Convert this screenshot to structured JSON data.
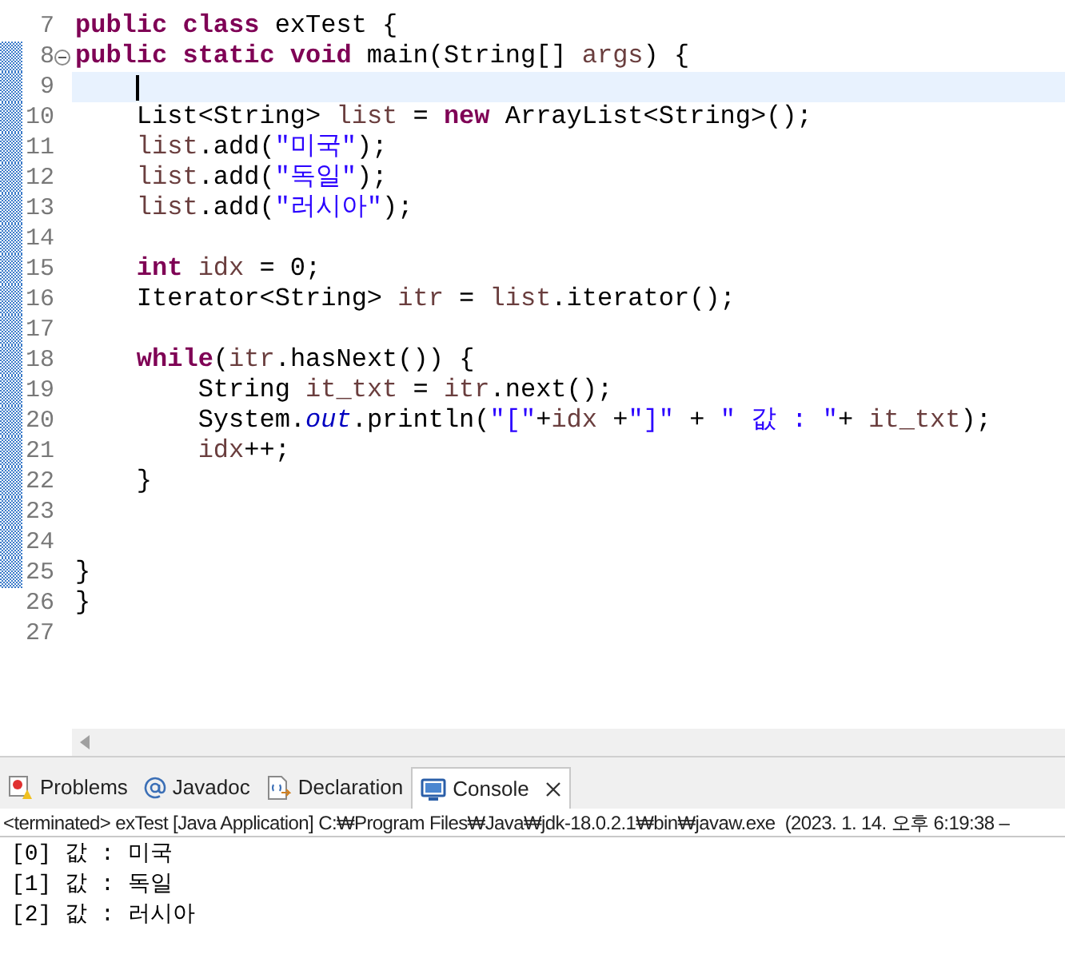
{
  "editor": {
    "lines": [
      {
        "number": "7",
        "foldable": false,
        "changed": false,
        "current": false,
        "tokens": [
          {
            "kind": "kw",
            "text": "public class"
          },
          {
            "kind": "plain",
            "text": " exTest {"
          }
        ]
      },
      {
        "number": "8",
        "foldable": true,
        "changed": true,
        "current": false,
        "tokens": [
          {
            "kind": "kw",
            "text": "public static void"
          },
          {
            "kind": "plain",
            "text": " main(String[] "
          },
          {
            "kind": "var",
            "text": "args"
          },
          {
            "kind": "plain",
            "text": ") {"
          }
        ],
        "children": [
          {
            "number": "9",
            "foldable": false,
            "changed": true,
            "current": true
          },
          {
            "number": "10",
            "foldable": false,
            "changed": true,
            "current": false,
            "tokens": [
              {
                "kind": "plain",
                "text": "List<String> "
              },
              {
                "kind": "var",
                "text": "list"
              },
              {
                "kind": "plain",
                "text": " = "
              },
              {
                "kind": "kw",
                "text": "new"
              },
              {
                "kind": "plain",
                "text": " ArrayList<String>();"
              }
            ]
          },
          {
            "number": "11",
            "foldable": false,
            "changed": true,
            "current": false,
            "tokens": [
              {
                "kind": "var",
                "text": "list"
              },
              {
                "kind": "plain",
                "text": ".add("
              },
              {
                "kind": "str",
                "text": "\"미국\""
              },
              {
                "kind": "plain",
                "text": ");"
              }
            ]
          },
          {
            "number": "12",
            "foldable": false,
            "changed": true,
            "current": false,
            "tokens": [
              {
                "kind": "var",
                "text": "list"
              },
              {
                "kind": "plain",
                "text": ".add("
              },
              {
                "kind": "str",
                "text": "\"독일\""
              },
              {
                "kind": "plain",
                "text": ");"
              }
            ]
          },
          {
            "number": "13",
            "foldable": false,
            "changed": true,
            "current": false,
            "tokens": [
              {
                "kind": "var",
                "text": "list"
              },
              {
                "kind": "plain",
                "text": ".add("
              },
              {
                "kind": "str",
                "text": "\"러시아\""
              },
              {
                "kind": "plain",
                "text": ");"
              }
            ]
          },
          {
            "number": "14",
            "foldable": false,
            "changed": true,
            "current": false
          },
          {
            "number": "15",
            "foldable": false,
            "changed": true,
            "current": false,
            "tokens": [
              {
                "kind": "kw",
                "text": "int "
              },
              {
                "kind": "var",
                "text": "idx"
              },
              {
                "kind": "plain",
                "text": " = 0;"
              }
            ]
          },
          {
            "number": "16",
            "foldable": false,
            "changed": true,
            "current": false,
            "tokens": [
              {
                "kind": "plain",
                "text": "Iterator<String> "
              },
              {
                "kind": "var",
                "text": "itr"
              },
              {
                "kind": "plain",
                "text": " = "
              },
              {
                "kind": "var",
                "text": "list"
              },
              {
                "kind": "plain",
                "text": ".iterator();"
              }
            ]
          },
          {
            "number": "17",
            "foldable": false,
            "changed": true,
            "current": false
          },
          {
            "number": "18",
            "foldable": false,
            "changed": true,
            "current": false,
            "tokens": [
              {
                "kind": "kw",
                "text": "while"
              },
              {
                "kind": "plain",
                "text": "("
              },
              {
                "kind": "var",
                "text": "itr"
              },
              {
                "kind": "plain",
                "text": ".hasNext()) {"
              }
            ],
            "children": [
              {
                "number": "19",
                "foldable": false,
                "changed": true,
                "current": false,
                "tokens": [
                  {
                    "kind": "plain",
                    "text": "String "
                  },
                  {
                    "kind": "var",
                    "text": "it_txt"
                  },
                  {
                    "kind": "plain",
                    "text": " = "
                  },
                  {
                    "kind": "var",
                    "text": "itr"
                  },
                  {
                    "kind": "plain",
                    "text": ".next();"
                  }
                ]
              },
              {
                "number": "20",
                "foldable": false,
                "changed": true,
                "current": false,
                "tokens": [
                  {
                    "kind": "plain",
                    "text": "System."
                  },
                  {
                    "kind": "field",
                    "text": "out"
                  },
                  {
                    "kind": "plain",
                    "text": ".println("
                  },
                  {
                    "kind": "str",
                    "text": "\"[\""
                  },
                  {
                    "kind": "plain",
                    "text": "+"
                  },
                  {
                    "kind": "var",
                    "text": "idx"
                  },
                  {
                    "kind": "plain",
                    "text": " +"
                  },
                  {
                    "kind": "str",
                    "text": "\"]\""
                  },
                  {
                    "kind": "plain",
                    "text": " + "
                  },
                  {
                    "kind": "str",
                    "text": "\" 값 : \""
                  },
                  {
                    "kind": "plain",
                    "text": "+ "
                  },
                  {
                    "kind": "var",
                    "text": "it_txt"
                  },
                  {
                    "kind": "plain",
                    "text": ");"
                  }
                ]
              },
              {
                "number": "21",
                "foldable": false,
                "changed": true,
                "current": false,
                "tokens": [
                  {
                    "kind": "var",
                    "text": "idx"
                  },
                  {
                    "kind": "plain",
                    "text": "++;"
                  }
                ]
              }
            ]
          },
          {
            "number": "22",
            "foldable": false,
            "changed": true,
            "current": false,
            "tokens": [
              {
                "kind": "plain",
                "text": "}"
              }
            ]
          },
          {
            "number": "23",
            "foldable": false,
            "changed": true,
            "current": false
          },
          {
            "number": "24",
            "foldable": false,
            "changed": true,
            "current": false
          }
        ]
      },
      {
        "number": "25",
        "foldable": false,
        "changed": true,
        "current": false,
        "tokens": [
          {
            "kind": "plain",
            "text": "}"
          }
        ]
      },
      {
        "number": "26",
        "foldable": false,
        "changed": false,
        "current": false,
        "tokens": [
          {
            "kind": "plain",
            "text": "}"
          }
        ]
      },
      {
        "number": "27",
        "foldable": false,
        "changed": false,
        "current": false
      }
    ]
  },
  "views": {
    "tabs": [
      {
        "kind": "problems",
        "label": "Problems",
        "selected": false
      },
      {
        "kind": "javadoc",
        "label": "Javadoc",
        "selected": false
      },
      {
        "kind": "declaration",
        "label": "Declaration",
        "selected": false
      },
      {
        "kind": "console",
        "label": "Console",
        "selected": true
      }
    ]
  },
  "console": {
    "status": "<terminated> exTest [Java Application] C:₩Program Files₩Java₩jdk-18.0.2.1₩bin₩javaw.exe  (2023. 1. 14. 오후 6:19:38 –",
    "output": [
      "[0] 값 : 미국",
      "[1] 값 : 독일",
      "[2] 값 : 러시아"
    ]
  }
}
